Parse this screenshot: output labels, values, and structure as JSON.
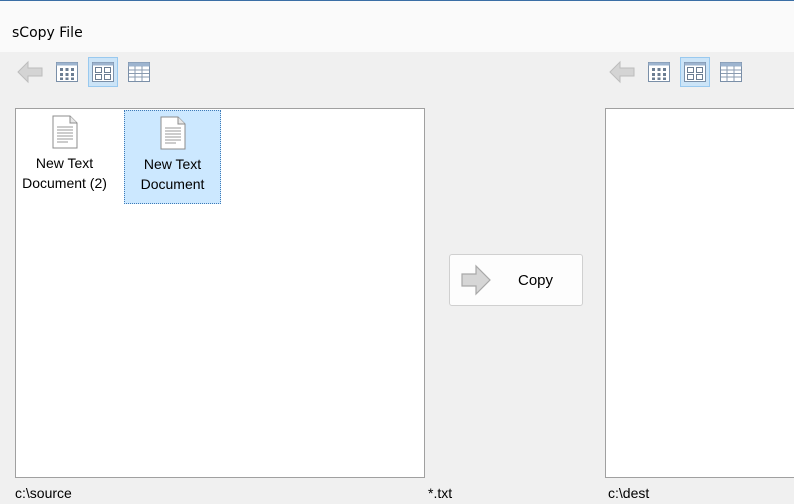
{
  "window": {
    "title": "sCopy File"
  },
  "source": {
    "path": "c:\\source",
    "files": [
      {
        "name": "New Text\nDocument (2)",
        "selected": false,
        "icon": "text-document-icon"
      },
      {
        "name": "New Text\nDocument",
        "selected": true,
        "icon": "text-document-icon"
      }
    ]
  },
  "toolbar": {
    "view_modes": [
      "large-icons",
      "medium-icons",
      "details"
    ],
    "active_view": "medium-icons"
  },
  "filter": {
    "pattern": "*.txt"
  },
  "action": {
    "copy_label": "Copy"
  },
  "destination": {
    "path": "c:\\dest",
    "files": []
  },
  "colors": {
    "selection": "#cce8ff",
    "active_view": "#cce4f7"
  }
}
